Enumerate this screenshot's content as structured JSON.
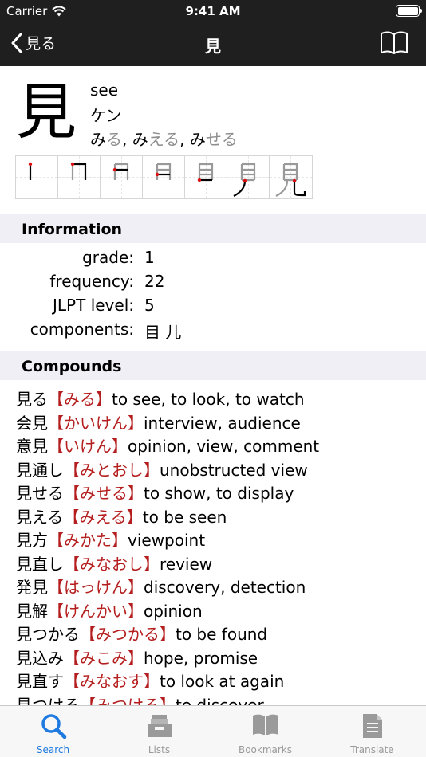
{
  "status": {
    "carrier": "Carrier",
    "time": "9:41 AM"
  },
  "nav": {
    "back_label": "見る",
    "title": "見"
  },
  "kanji": {
    "character": "見",
    "meaning": "see",
    "onyomi": "ケン",
    "kunyomi": [
      {
        "stem": "み",
        "okurigana": "る",
        "sep": ", "
      },
      {
        "stem": "み",
        "okurigana": "える",
        "sep": ", "
      },
      {
        "stem": "み",
        "okurigana": "せる",
        "sep": ""
      }
    ],
    "stroke_count": 7
  },
  "information": {
    "header": "Information",
    "rows": [
      {
        "label": "grade:",
        "value": "1"
      },
      {
        "label": "frequency:",
        "value": "22"
      },
      {
        "label": "JLPT level:",
        "value": "5"
      },
      {
        "label": "components:",
        "value": "目 儿"
      }
    ]
  },
  "compounds": {
    "header": "Compounds",
    "items": [
      {
        "word": "見る",
        "reading": "【みる】",
        "meaning": "to see, to look, to watch"
      },
      {
        "word": "会見",
        "reading": "【かいけん】",
        "meaning": "interview, audience"
      },
      {
        "word": "意見",
        "reading": "【いけん】",
        "meaning": "opinion, view, comment"
      },
      {
        "word": "見通し",
        "reading": "【みとおし】",
        "meaning": "unobstructed view"
      },
      {
        "word": "見せる",
        "reading": "【みせる】",
        "meaning": "to show, to display"
      },
      {
        "word": "見える",
        "reading": "【みえる】",
        "meaning": "to be seen"
      },
      {
        "word": "見方",
        "reading": "【みかた】",
        "meaning": "viewpoint"
      },
      {
        "word": "見直し",
        "reading": "【みなおし】",
        "meaning": "review"
      },
      {
        "word": "発見",
        "reading": "【はっけん】",
        "meaning": "discovery, detection"
      },
      {
        "word": "見解",
        "reading": "【けんかい】",
        "meaning": "opinion"
      },
      {
        "word": "見つかる",
        "reading": "【みつかる】",
        "meaning": "to be found"
      },
      {
        "word": "見込み",
        "reading": "【みこみ】",
        "meaning": "hope, promise"
      },
      {
        "word": "見直す",
        "reading": "【みなおす】",
        "meaning": "to look at again"
      },
      {
        "word": "見つける",
        "reading": "【みつける】",
        "meaning": "to discover"
      }
    ]
  },
  "tabs": [
    {
      "label": "Search",
      "icon": "magnifier-icon",
      "active": true
    },
    {
      "label": "Lists",
      "icon": "tray-icon",
      "active": false
    },
    {
      "label": "Bookmarks",
      "icon": "book-icon",
      "active": false
    },
    {
      "label": "Translate",
      "icon": "document-icon",
      "active": false
    }
  ],
  "colors": {
    "bar": "#1f1f1f",
    "reading_red": "#b51e1e",
    "okurigana_gray": "#8e8e8e",
    "section_bg": "#f0eff5",
    "tab_active": "#1e7ae0",
    "tab_inactive": "#9a9a9a"
  }
}
